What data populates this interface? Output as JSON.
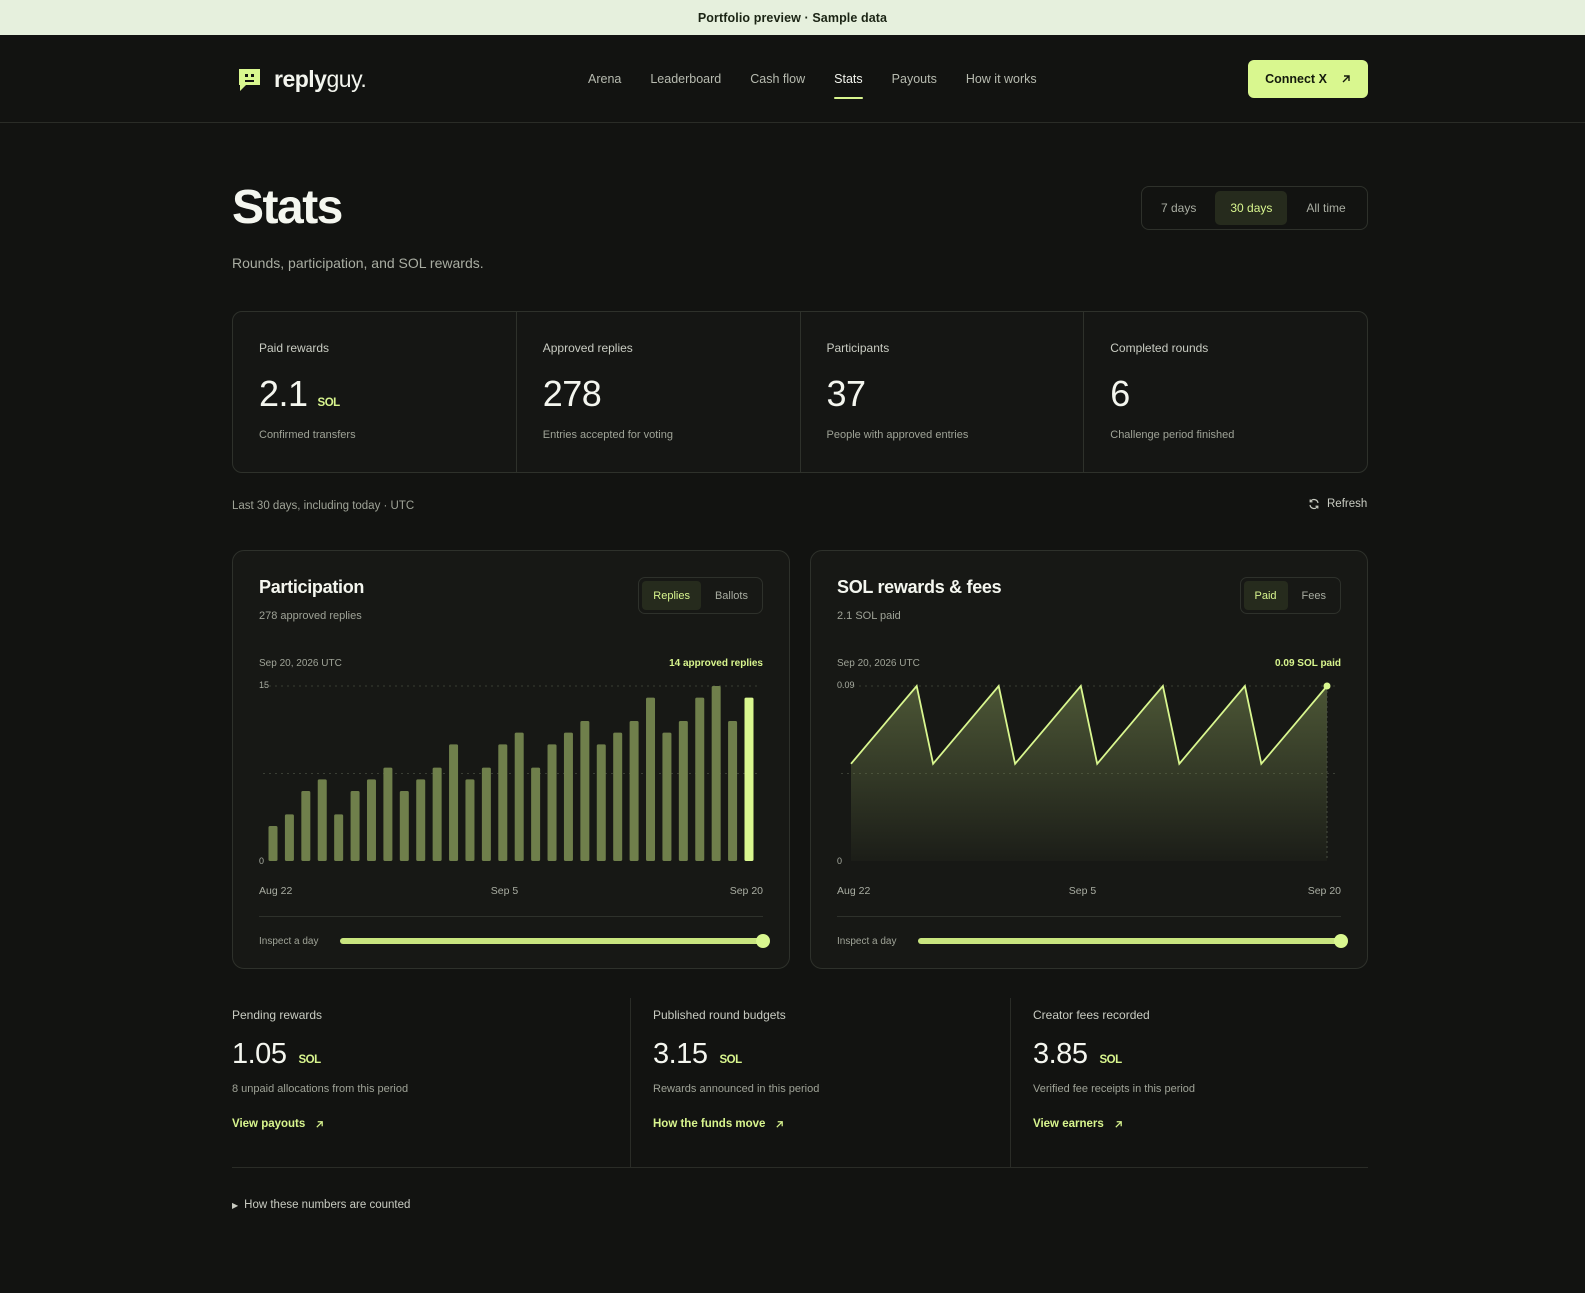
{
  "banner": "Portfolio preview · Sample data",
  "brand": {
    "bold": "reply",
    "light": "guy."
  },
  "nav": [
    "Arena",
    "Leaderboard",
    "Cash flow",
    "Stats",
    "Payouts",
    "How it works"
  ],
  "nav_active": 3,
  "connect_label": "Connect X",
  "page": {
    "title": "Stats",
    "subtitle": "Rounds, participation, and SOL rewards."
  },
  "range": {
    "options": [
      "7 days",
      "30 days",
      "All time"
    ],
    "active": 1
  },
  "kpis": [
    {
      "label": "Paid rewards",
      "value": "2.1",
      "unit": "SOL",
      "note": "Confirmed transfers"
    },
    {
      "label": "Approved replies",
      "value": "278",
      "unit": "",
      "note": "Entries accepted for voting"
    },
    {
      "label": "Participants",
      "value": "37",
      "unit": "",
      "note": "People with approved entries"
    },
    {
      "label": "Completed rounds",
      "value": "6",
      "unit": "",
      "note": "Challenge period finished"
    }
  ],
  "meta_line": "Last 30 days, including today · UTC",
  "refresh_label": "Refresh",
  "participation": {
    "title": "Participation",
    "subtitle": "278 approved replies",
    "toggles": [
      "Replies",
      "Ballots"
    ],
    "active": 0,
    "selected_date": "Sep 20, 2026 UTC",
    "selected_value": "14 approved replies",
    "inspect_label": "Inspect a day"
  },
  "rewards": {
    "title": "SOL rewards & fees",
    "subtitle": "2.1 SOL paid",
    "toggles": [
      "Paid",
      "Fees"
    ],
    "active": 0,
    "selected_date": "Sep 20, 2026 UTC",
    "selected_value": "0.09 SOL paid",
    "inspect_label": "Inspect a day"
  },
  "chart_data": [
    {
      "type": "bar",
      "categories": [
        "Aug 22",
        "Aug 23",
        "Aug 24",
        "Aug 25",
        "Aug 26",
        "Aug 27",
        "Aug 28",
        "Aug 29",
        "Aug 30",
        "Aug 31",
        "Sep 1",
        "Sep 2",
        "Sep 3",
        "Sep 4",
        "Sep 5",
        "Sep 6",
        "Sep 7",
        "Sep 8",
        "Sep 9",
        "Sep 10",
        "Sep 11",
        "Sep 12",
        "Sep 13",
        "Sep 14",
        "Sep 15",
        "Sep 16",
        "Sep 17",
        "Sep 18",
        "Sep 19",
        "Sep 20"
      ],
      "values": [
        3,
        4,
        6,
        7,
        4,
        6,
        7,
        8,
        6,
        7,
        8,
        10,
        7,
        8,
        10,
        11,
        8,
        10,
        11,
        12,
        10,
        11,
        12,
        14,
        11,
        12,
        14,
        15,
        12,
        14
      ],
      "ylim": [
        0,
        15
      ],
      "yticks": [
        "0",
        "15"
      ],
      "xticks": [
        "Aug 22",
        "Sep 5",
        "Sep 20"
      ],
      "highlight_index": 29,
      "grid": true
    },
    {
      "type": "area",
      "categories": [
        "Aug 22",
        "Aug 23",
        "Aug 24",
        "Aug 25",
        "Aug 26",
        "Aug 27",
        "Aug 28",
        "Aug 29",
        "Aug 30",
        "Aug 31",
        "Sep 1",
        "Sep 2",
        "Sep 3",
        "Sep 4",
        "Sep 5",
        "Sep 6",
        "Sep 7",
        "Sep 8",
        "Sep 9",
        "Sep 10",
        "Sep 11",
        "Sep 12",
        "Sep 13",
        "Sep 14",
        "Sep 15",
        "Sep 16",
        "Sep 17",
        "Sep 18",
        "Sep 19",
        "Sep 20"
      ],
      "values": [
        0.05,
        0.06,
        0.07,
        0.08,
        0.09,
        0.05,
        0.06,
        0.07,
        0.08,
        0.09,
        0.05,
        0.06,
        0.07,
        0.08,
        0.09,
        0.05,
        0.06,
        0.07,
        0.08,
        0.09,
        0.05,
        0.06,
        0.07,
        0.08,
        0.09,
        0.05,
        0.06,
        0.07,
        0.08,
        0.09
      ],
      "ylim": [
        0,
        0.09
      ],
      "yticks": [
        "0",
        "0.09"
      ],
      "xticks": [
        "Aug 22",
        "Sep 5",
        "Sep 20"
      ],
      "highlight_index": 29,
      "grid": true
    }
  ],
  "bottom": [
    {
      "label": "Pending rewards",
      "value": "1.05",
      "unit": "SOL",
      "note": "8 unpaid allocations from this period",
      "link": "View payouts"
    },
    {
      "label": "Published round budgets",
      "value": "3.15",
      "unit": "SOL",
      "note": "Rewards announced in this period",
      "link": "How the funds move"
    },
    {
      "label": "Creator fees recorded",
      "value": "3.85",
      "unit": "SOL",
      "note": "Verified fee receipts in this period",
      "link": "View earners"
    }
  ],
  "details_label": "How these numbers are counted",
  "colors": {
    "accent": "#d9f78f",
    "bar": "#6f7f4b",
    "background": "#121311"
  }
}
